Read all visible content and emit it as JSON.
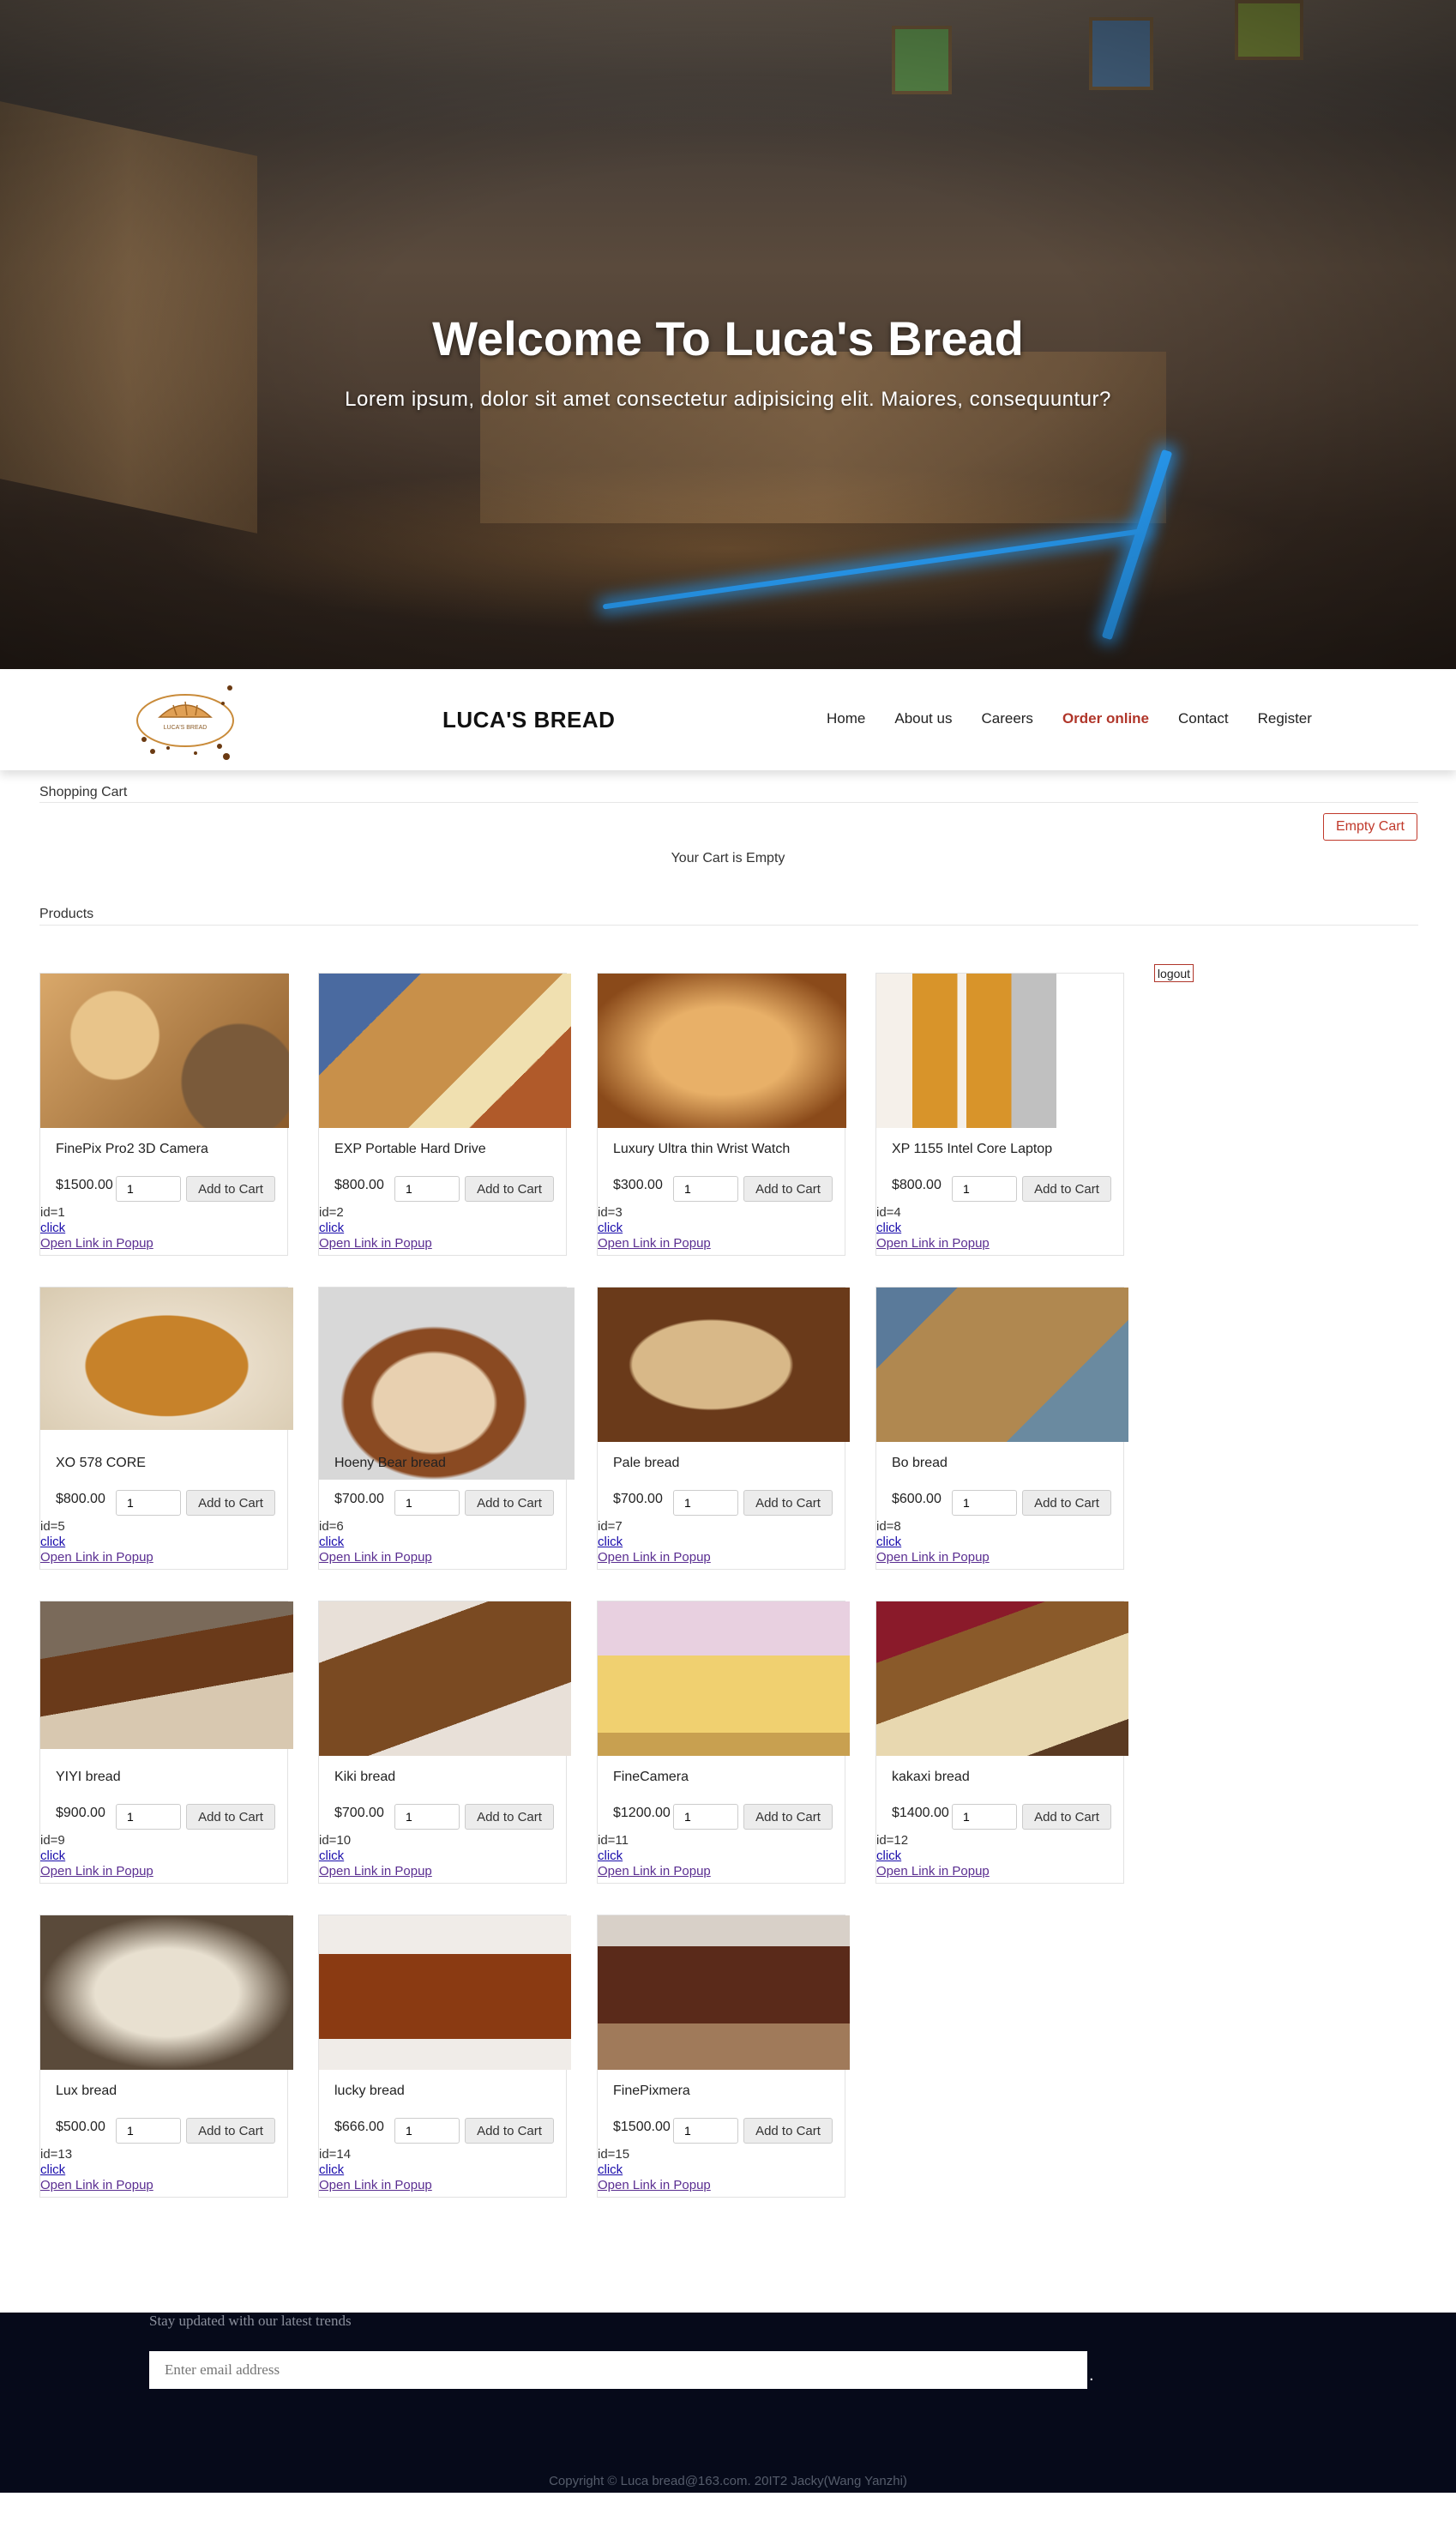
{
  "hero": {
    "title": "Welcome To Luca's Bread",
    "subtitle": "Lorem ipsum, dolor sit amet consectetur adipisicing elit. Maiores, consequuntur?"
  },
  "nav": {
    "logo_text": "LUCA'S BREAD",
    "brand": "LUCA'S BREAD",
    "items": [
      {
        "label": "Home"
      },
      {
        "label": "About us"
      },
      {
        "label": "Careers"
      },
      {
        "label": "Order online",
        "active": true
      },
      {
        "label": "Contact"
      },
      {
        "label": "Register"
      }
    ],
    "accent_color": "#b0362a"
  },
  "cart": {
    "title": "Shopping Cart",
    "empty_button": "Empty Cart",
    "empty_message": "Your Cart is Empty"
  },
  "products_section": {
    "title": "Products",
    "logout_label": "logout",
    "add_label": "Add to Cart",
    "click_label": "click",
    "popup_label": "Open Link in Popup",
    "items": [
      {
        "name": "FinePix Pro2 3D Camera",
        "price": "$1500.00",
        "qty": "1",
        "id_text": "id=1"
      },
      {
        "name": "EXP Portable Hard Drive",
        "price": "$800.00",
        "qty": "1",
        "id_text": "id=2"
      },
      {
        "name": "Luxury Ultra thin Wrist Watch",
        "price": "$300.00",
        "qty": "1",
        "id_text": "id=3"
      },
      {
        "name": "XP 1155 Intel Core Laptop",
        "price": "$800.00",
        "qty": "1",
        "id_text": "id=4"
      },
      {
        "name": "XO 578 CORE",
        "price": "$800.00",
        "qty": "1",
        "id_text": "id=5"
      },
      {
        "name": "Hoeny Bear bread",
        "price": "$700.00",
        "qty": "1",
        "id_text": "id=6"
      },
      {
        "name": "Pale bread",
        "price": "$700.00",
        "qty": "1",
        "id_text": "id=7"
      },
      {
        "name": "Bo bread",
        "price": "$600.00",
        "qty": "1",
        "id_text": "id=8"
      },
      {
        "name": "YIYI bread",
        "price": "$900.00",
        "qty": "1",
        "id_text": "id=9"
      },
      {
        "name": "Kiki bread",
        "price": "$700.00",
        "qty": "1",
        "id_text": "id=10"
      },
      {
        "name": "FineCamera",
        "price": "$1200.00",
        "qty": "1",
        "id_text": "id=11"
      },
      {
        "name": "kakaxi bread",
        "price": "$1400.00",
        "qty": "1",
        "id_text": "id=12"
      },
      {
        "name": "Lux bread",
        "price": "$500.00",
        "qty": "1",
        "id_text": "id=13"
      },
      {
        "name": "lucky bread",
        "price": "$666.00",
        "qty": "1",
        "id_text": "id=14"
      },
      {
        "name": "FinePixmera",
        "price": "$1500.00",
        "qty": "1",
        "id_text": "id=15"
      }
    ]
  },
  "footer": {
    "newsletter_text": "Stay updated with our latest trends",
    "email_placeholder": "Enter email address",
    "dot": ".",
    "copyright": "Copyright © Luca bread@163.com.     20IT2 Jacky(Wang Yanzhi)"
  }
}
